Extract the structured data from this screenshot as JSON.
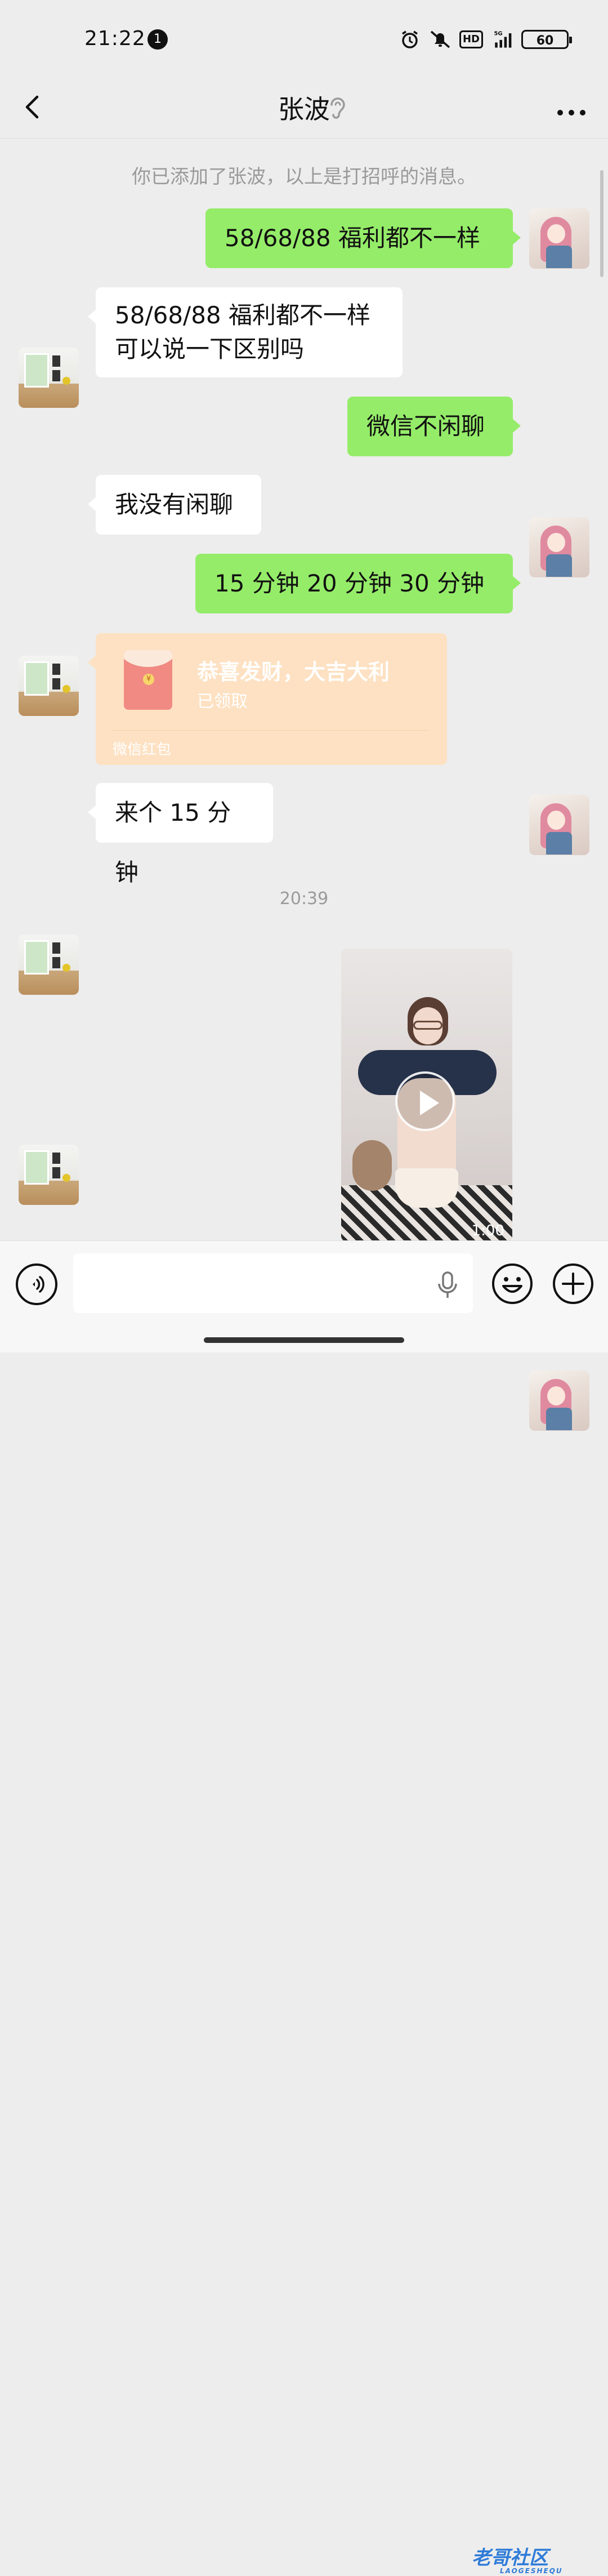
{
  "status_bar": {
    "time": "21:22",
    "notification_count": "1",
    "network": "5G",
    "hd": "HD",
    "battery": "60"
  },
  "header": {
    "title": "张波"
  },
  "chat": {
    "system_message": "你已添加了张波，以上是打招呼的消息。",
    "messages": [
      {
        "side": "out",
        "text": "58/68/88 福利都不一样"
      },
      {
        "side": "in",
        "text": "58/68/88 福利都不一样\n可以说一下区别吗"
      },
      {
        "side": "out",
        "text": "微信不闲聊"
      },
      {
        "side": "in",
        "text": "我没有闲聊"
      },
      {
        "side": "out",
        "text": "15 分钟  20 分钟  30 分钟"
      },
      {
        "side": "in",
        "type": "red_packet",
        "title": "恭喜发财，大吉大利",
        "status": "已领取",
        "footer": "微信红包"
      },
      {
        "side": "in",
        "text": "来个 15 分钟"
      },
      {
        "type": "timestamp",
        "text": "20:39"
      },
      {
        "side": "out",
        "type": "video",
        "duration": "1:00"
      }
    ]
  },
  "watermark": {
    "text": "老哥社区",
    "sub": "LAOGESHEQU"
  },
  "colors": {
    "background": "#ededed",
    "outgoing_bubble": "#95ec69",
    "incoming_bubble": "#ffffff",
    "red_packet_received": "#fde1c2"
  }
}
